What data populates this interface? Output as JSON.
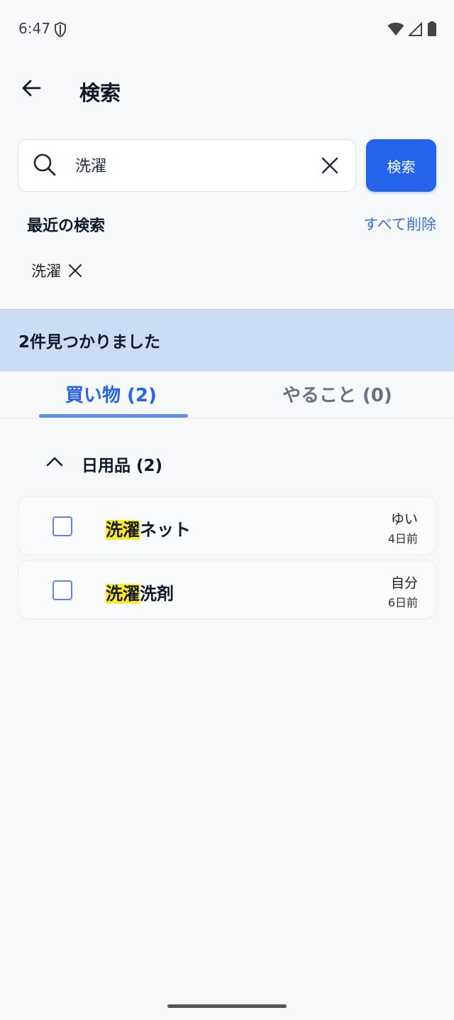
{
  "status_bar": {
    "time": "6:47"
  },
  "header": {
    "title": "検索"
  },
  "search": {
    "query": "洗濯",
    "button_label": "検索"
  },
  "recent": {
    "heading": "最近の検索",
    "clear_all_label": "すべて削除",
    "items": [
      {
        "label": "洗濯"
      }
    ]
  },
  "results": {
    "summary": "2件見つかりました"
  },
  "tabs": [
    {
      "label": "買い物 (2)",
      "selected": true
    },
    {
      "label": "やること (0)",
      "selected": false
    }
  ],
  "group": {
    "title": "日用品 (2)",
    "expanded": true
  },
  "items": [
    {
      "highlight": "洗濯",
      "rest": "ネット",
      "owner": "ゆい",
      "time": "4日前",
      "checked": false
    },
    {
      "highlight": "洗濯",
      "rest": "洗剤",
      "owner": "自分",
      "time": "6日前",
      "checked": false
    }
  ],
  "colors": {
    "accent": "#2563eb",
    "result_bar": "#ccdcf7",
    "highlight": "#fde92e",
    "background": "#f7f9fb"
  },
  "icons": {
    "back": "arrow-left-icon",
    "search": "search-icon",
    "clear": "close-icon",
    "chip_remove": "close-icon",
    "group_toggle": "chevron-up-icon",
    "status": [
      "shield-icon",
      "wifi-icon",
      "cellular-icon",
      "battery-icon"
    ]
  }
}
